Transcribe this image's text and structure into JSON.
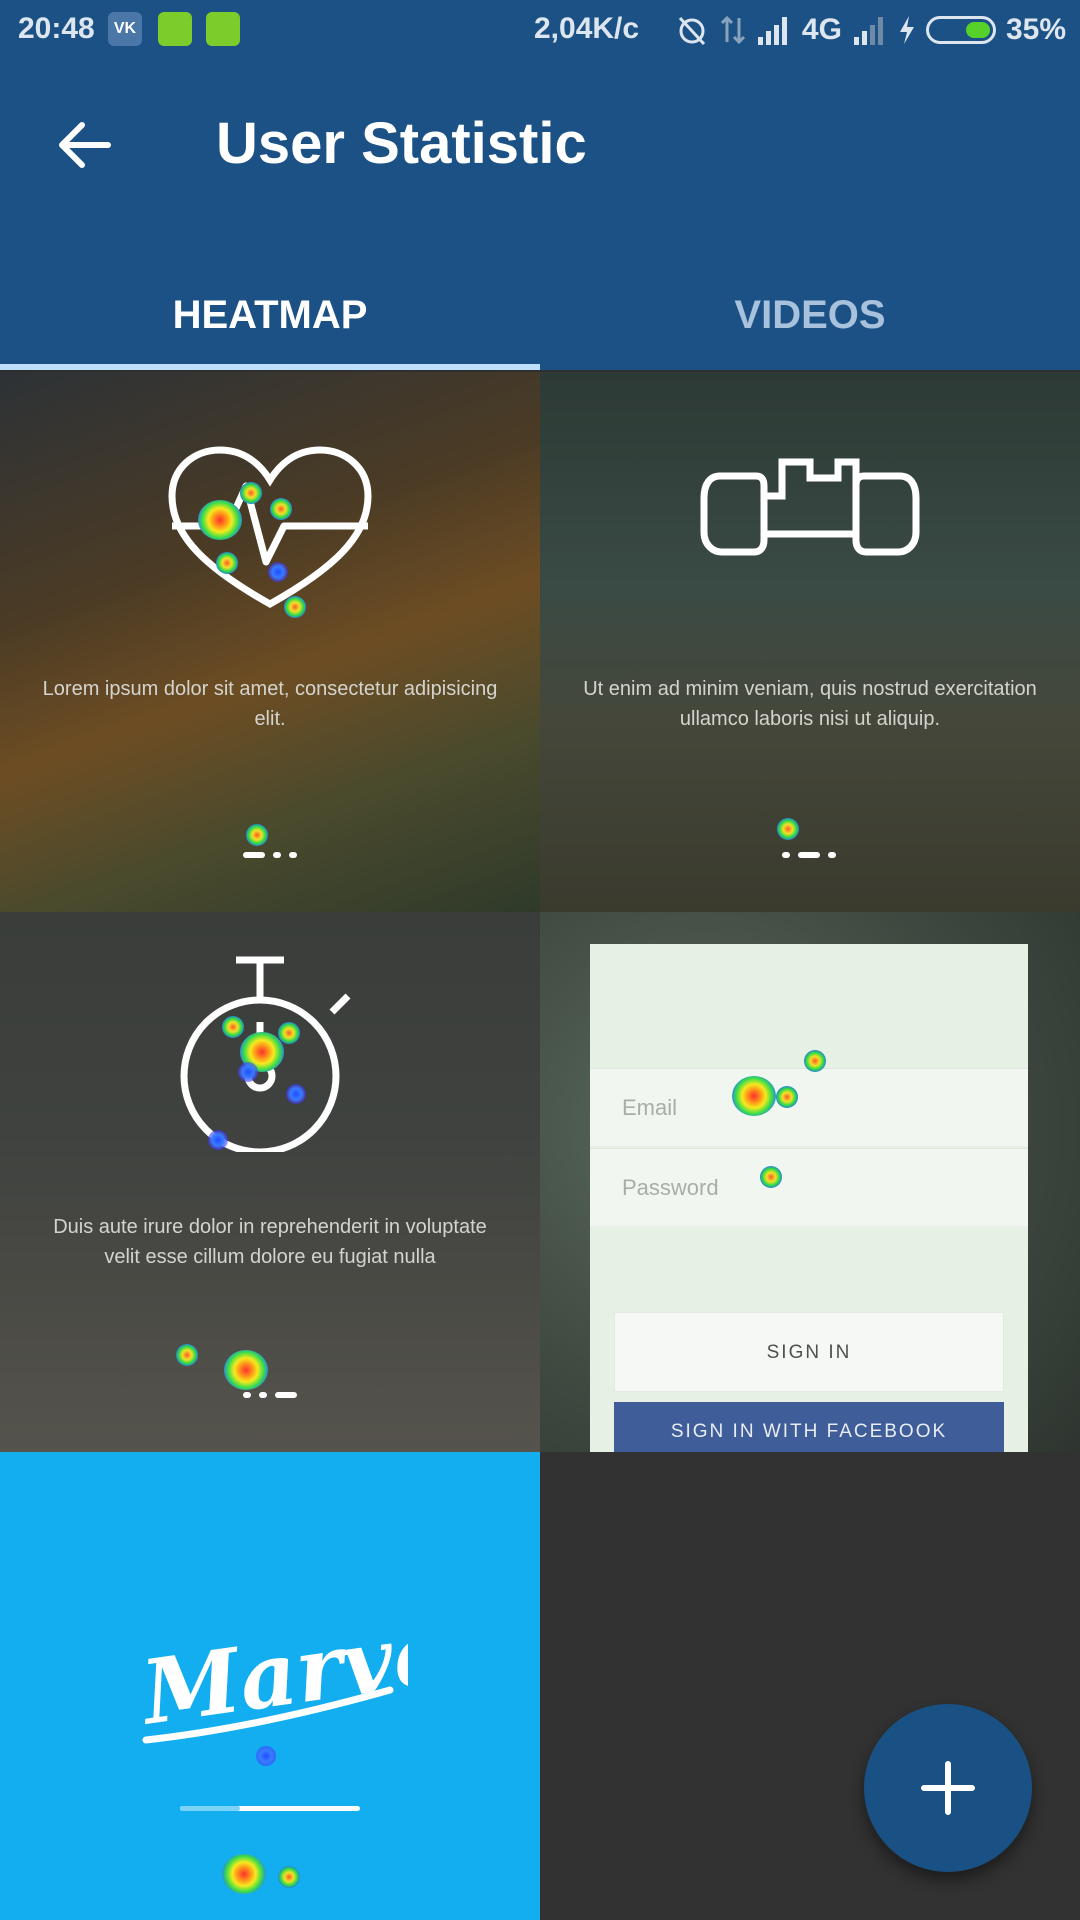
{
  "status_bar": {
    "time": "20:48",
    "vk_label": "VK",
    "net_speed": "2,04K/c",
    "network_type": "4G",
    "battery_percent": "35%",
    "icons": [
      "vk-icon",
      "phone-app-icon",
      "android-app-icon",
      "alarm-off-icon",
      "data-transfer-icon",
      "signal-icon",
      "signal-weak-icon",
      "charging-icon",
      "battery-icon"
    ]
  },
  "app_bar": {
    "title": "User Statistic",
    "back_icon": "arrow-left-icon"
  },
  "tabs": [
    {
      "label": "HEATMAP",
      "selected": true
    },
    {
      "label": "VIDEOS",
      "selected": false
    }
  ],
  "tiles": [
    {
      "icon": "heart-pulse-icon",
      "text": "Lorem ipsum dolor sit amet, consectetur adipisicing elit.",
      "page_index": 1,
      "page_count": 3
    },
    {
      "icon": "dumbbell-icon",
      "text": "Ut enim ad minim veniam, quis nostrud exercitation ullamco laboris nisi ut aliquip.",
      "page_index": 2,
      "page_count": 3
    },
    {
      "icon": "stopwatch-icon",
      "text": "Duis aute irure dolor in reprehenderit in voluptate velit esse cillum dolore eu fugiat nulla",
      "page_index": 3,
      "page_count": 3
    },
    {
      "login": {
        "email_placeholder": "Email",
        "password_placeholder": "Password",
        "sign_in": "SIGN IN",
        "sign_in_facebook": "SIGN IN WITH FACEBOOK"
      }
    },
    {
      "logo": "Marvel",
      "progress": 0.33
    },
    {}
  ],
  "fab": {
    "icon": "plus-icon"
  },
  "colors": {
    "primary": "#1b5184",
    "tab_indicator": "#bfe0fb",
    "marvel_blue": "#13aef0",
    "facebook": "#3f5d98"
  }
}
